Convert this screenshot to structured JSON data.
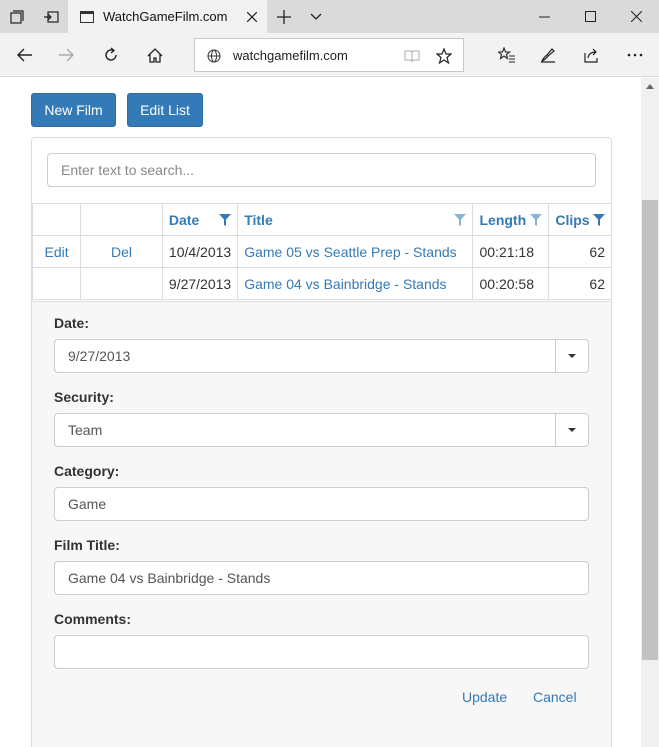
{
  "browser": {
    "tab_title": "WatchGameFilm.com",
    "url": "watchgamefilm.com"
  },
  "toolbar": {
    "new_film_label": "New Film",
    "edit_list_label": "Edit List"
  },
  "search": {
    "placeholder": "Enter text to search..."
  },
  "grid": {
    "columns": [
      "",
      "",
      "Date",
      "Title",
      "Length",
      "Clips"
    ],
    "rows": [
      {
        "edit": "Edit",
        "del": "Del",
        "date": "10/4/2013",
        "title": "Game 05 vs Seattle Prep - Stands",
        "length": "00:21:18",
        "clips": "62"
      },
      {
        "edit": "",
        "del": "",
        "date": "9/27/2013",
        "title": "Game 04 vs Bainbridge - Stands",
        "length": "00:20:58",
        "clips": "62"
      }
    ]
  },
  "form": {
    "date_label": "Date:",
    "date_value": "9/27/2013",
    "security_label": "Security:",
    "security_value": "Team",
    "category_label": "Category:",
    "category_value": "Game",
    "film_title_label": "Film Title:",
    "film_title_value": "Game 04 vs Bainbridge - Stands",
    "comments_label": "Comments:",
    "comments_value": "",
    "update_label": "Update",
    "cancel_label": "Cancel"
  },
  "colors": {
    "accent": "#337ab7",
    "chrome": "#dadada"
  }
}
